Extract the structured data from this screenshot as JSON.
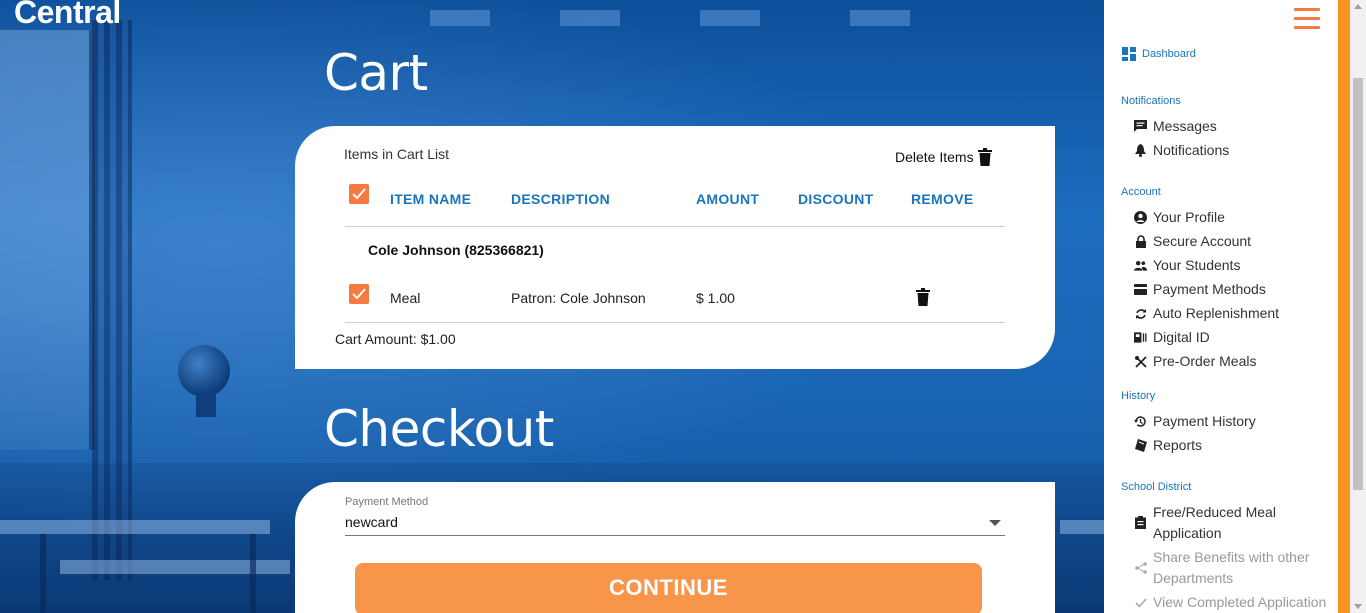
{
  "brand": {
    "logo_text": "Central"
  },
  "cart": {
    "title": "Cart",
    "caption": "Items in Cart List",
    "delete_label": "Delete Items",
    "headers": {
      "item_name": "ITEM NAME",
      "description": "DESCRIPTION",
      "amount": "AMOUNT",
      "discount": "DISCOUNT",
      "remove": "REMOVE"
    },
    "patron": "Cole Johnson (825366821)",
    "items": [
      {
        "name": "Meal",
        "description": "Patron: Cole Johnson",
        "amount": "$ 1.00",
        "discount": ""
      }
    ],
    "total": "Cart Amount: $1.00"
  },
  "checkout": {
    "title": "Checkout",
    "payment_label": "Payment Method",
    "payment_value": "newcard",
    "continue_label": "CONTINUE"
  },
  "sidebar": {
    "dashboard": "Dashboard",
    "groups": {
      "notifications": "Notifications",
      "account": "Account",
      "history": "History",
      "district": "School District"
    },
    "links": {
      "messages": "Messages",
      "notifications": "Notifications",
      "profile": "Your Profile",
      "secure": "Secure Account",
      "students": "Your Students",
      "payment_methods": "Payment Methods",
      "auto_replenish": "Auto Replenishment",
      "digital_id": "Digital ID",
      "preorder": "Pre-Order Meals",
      "payment_history": "Payment History",
      "reports": "Reports",
      "free_reduced": "Free/Reduced Meal Application",
      "share_benefits": "Share Benefits with other Departments",
      "view_completed": "View Completed Application"
    }
  },
  "colors": {
    "accent_orange": "#f47a40",
    "button_orange": "#f7964a",
    "link_blue": "#1b75bc",
    "background_blue": "#1a5a9c"
  }
}
